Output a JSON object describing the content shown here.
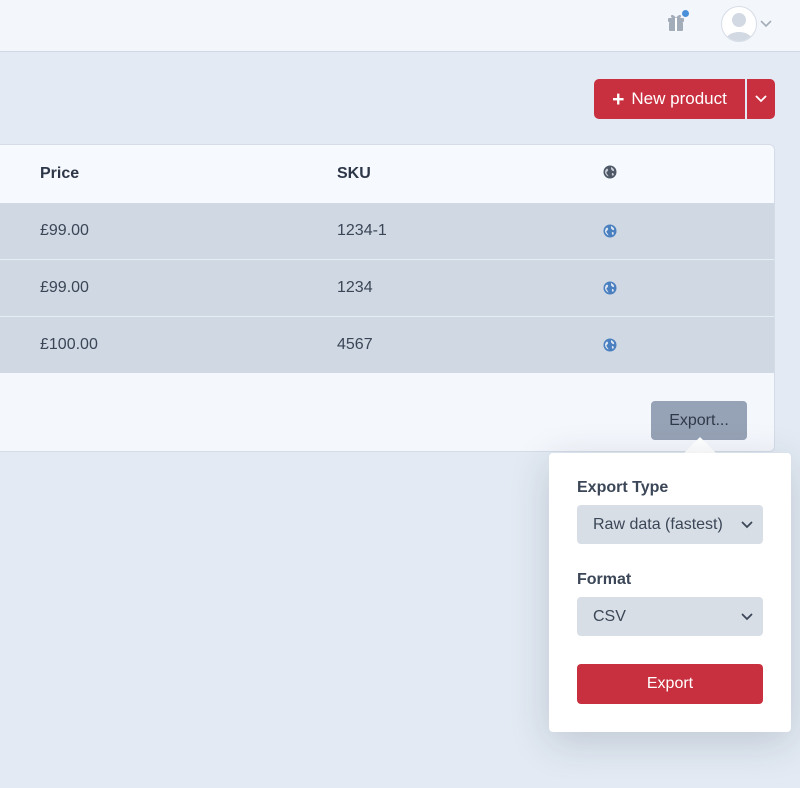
{
  "header": {
    "gift_icon": "gift-icon",
    "avatar_icon": "user-avatar-icon",
    "avatar_menu_icon": "chevron-down-icon"
  },
  "toolbar": {
    "new_product_label": "New product",
    "new_product_icon": "plus-icon",
    "split_icon": "chevron-down-icon"
  },
  "table": {
    "columns": {
      "price": "Price",
      "sku": "SKU",
      "visibility_icon": "globe-icon"
    },
    "rows": [
      {
        "price": "£99.00",
        "sku": "1234-1"
      },
      {
        "price": "£99.00",
        "sku": "1234"
      },
      {
        "price": "£100.00",
        "sku": "4567"
      }
    ],
    "export_trigger_label": "Export..."
  },
  "export_popover": {
    "export_type_label": "Export Type",
    "export_type_value": "Raw data (fastest)",
    "format_label": "Format",
    "format_value": "CSV",
    "submit_label": "Export"
  },
  "colors": {
    "brand_red": "#c9303f",
    "globe_blue": "#4a7fc0",
    "notification_dot": "#4a90d9"
  }
}
